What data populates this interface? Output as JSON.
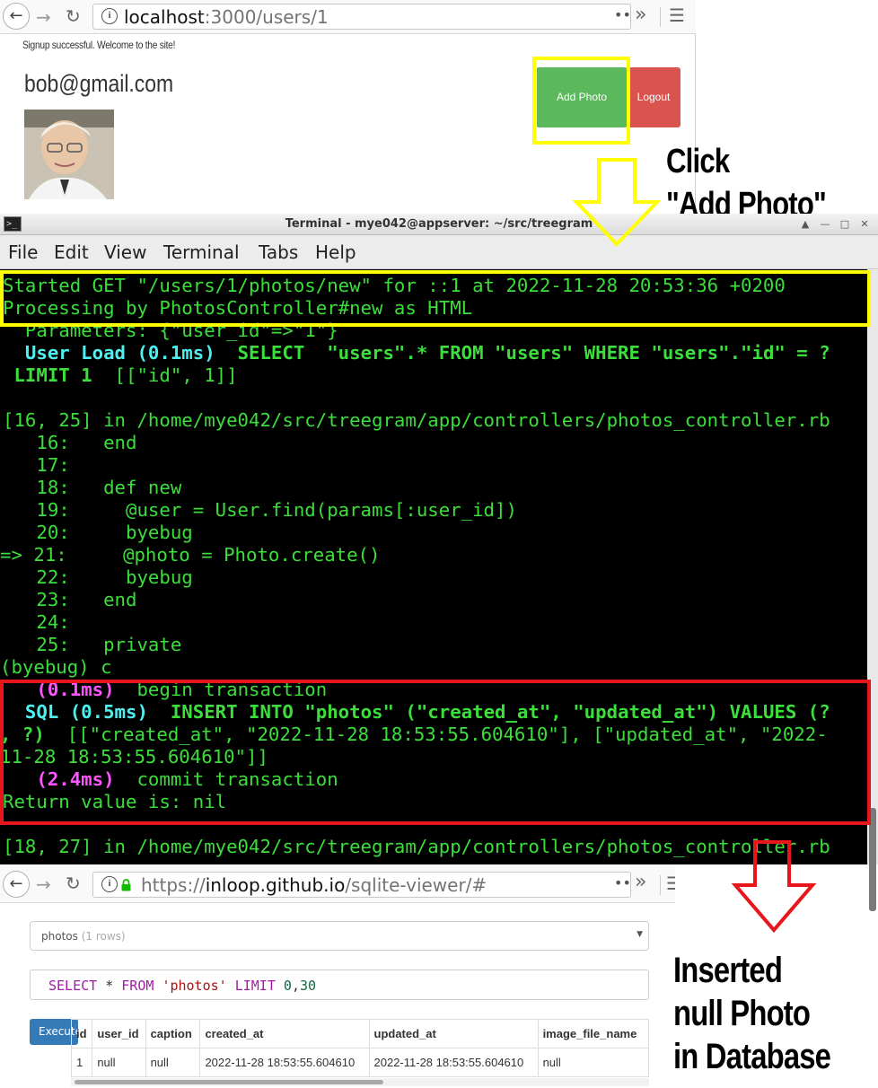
{
  "browser_top": {
    "url_host": "localhost",
    "url_rest": ":3000/users/1",
    "page": {
      "flash": "Signup successful. Welcome to the site!",
      "email": "bob@gmail.com",
      "add_photo_label": "Add Photo",
      "logout_label": "Logout"
    }
  },
  "annotations": {
    "click_line1": "Click",
    "click_line2": "\"Add Photo\"",
    "inserted_line1": "Inserted",
    "inserted_line2": "null Photo",
    "inserted_line3": "in Database",
    "highlight_colors": {
      "yellow": "#ffff00",
      "red": "#e8151b"
    }
  },
  "terminal": {
    "title": "Terminal - mye042@appserver: ~/src/treegram",
    "menu": [
      "File",
      "Edit",
      "View",
      "Terminal",
      "Tabs",
      "Help"
    ],
    "lines": [
      "Started GET \"/users/1/photos/new\" for ::1 at 2022-11-28 20:53:36 +0200",
      "Processing by PhotosController#new as HTML",
      "  Parameters: {\"user_id\"=>\"1\"}",
      "  User Load (0.1ms)",
      "  SELECT  \"users\".* FROM \"users\" WHERE \"users\".\"id\" = ?",
      " LIMIT 1",
      "  [[\"id\", 1]]",
      "",
      "[16, 25] in /home/mye042/src/treegram/app/controllers/photos_controller.rb",
      "   16:   end",
      "   17: ",
      "   18:   def new",
      "   19:     @user = User.find(params[:user_id])",
      "   20:     byebug",
      "=> 21:     @photo = Photo.create()",
      "   22:     byebug",
      "   23:   end",
      "   24: ",
      "   25:   private",
      "(byebug) c",
      "   (0.1ms)",
      "  begin transaction",
      "  SQL (0.5ms)",
      "  INSERT INTO \"photos\" (\"created_at\", \"updated_at\") VALUES (?",
      ", ?)",
      "  [[\"created_at\", \"2022-11-28 18:53:55.604610\"], [\"updated_at\", \"2022-",
      "11-28 18:53:55.604610\"]]",
      "   (2.4ms)",
      "  commit transaction",
      "Return value is: nil",
      "",
      "[18, 27] in /home/mye042/src/treegram/app/controllers/photos_controller.rb"
    ]
  },
  "browser_bottom": {
    "url_scheme": "https://",
    "url_host": "inloop.github.io",
    "url_rest": "/sqlite-viewer/#",
    "table_select": {
      "name": "photos",
      "count": "(1 rows)"
    },
    "query": {
      "kw1": "SELECT",
      "mid": " * ",
      "kw2": "FROM",
      "table": "'photos'",
      "kw3": "LIMIT",
      "n1": "0",
      "comma": ",",
      "n2": "30"
    },
    "execute_label": "Execute",
    "columns": [
      "id",
      "user_id",
      "caption",
      "created_at",
      "updated_at",
      "image_file_name"
    ],
    "rows": [
      [
        "1",
        "null",
        "null",
        "2022-11-28 18:53:55.604610",
        "2022-11-28 18:53:55.604610",
        "null"
      ]
    ]
  }
}
